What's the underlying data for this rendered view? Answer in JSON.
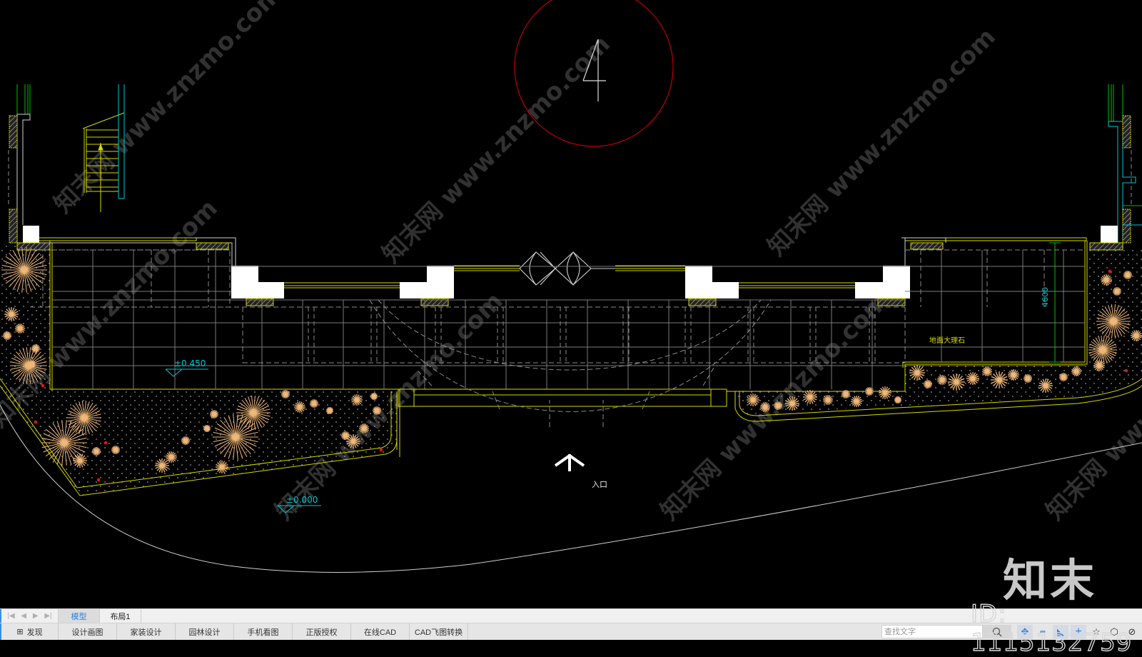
{
  "drawing": {
    "section_marker": "4",
    "level_upper": "±0.450",
    "level_lower": "±0.000",
    "dimension": "4600",
    "material_label": "地面大理石",
    "entrance_label": "入口",
    "watermark_url": "www.znzmo.com",
    "watermark_brand": "知末网",
    "logo_text": "知末",
    "id_text": "ID: 1115132759",
    "colors": {
      "background": "#000000",
      "wall": "#ffffff",
      "yellow_line": "#d8d800",
      "grid_line": "#8a8a8a",
      "cyan": "#00c8d8",
      "green": "#00c000",
      "plant": "#f0b878",
      "section_circle": "#c00000",
      "red_dot": "#ff1010"
    }
  },
  "layout_tabs": {
    "nav": [
      "first-icon",
      "prev-icon",
      "next-icon",
      "last-icon"
    ],
    "tabs": [
      {
        "label": "模型",
        "active": true
      },
      {
        "label": "布局1",
        "active": false
      }
    ]
  },
  "toolbar": {
    "buttons": [
      {
        "label": "发现",
        "icon": "grid-icon"
      },
      {
        "label": "设计画图"
      },
      {
        "label": "家装设计"
      },
      {
        "label": "园林设计"
      },
      {
        "label": "手机看图"
      },
      {
        "label": "正版授权"
      },
      {
        "label": "在线CAD"
      },
      {
        "label": "CAD飞图转换"
      }
    ],
    "search_placeholder": "查找文字",
    "search_value": "",
    "icons": [
      "snap-points-icon",
      "ortho-north-icon",
      "measure-icon",
      "crosshair-icon",
      "favorite-star-icon",
      "3d-box-icon",
      "orbit-icon"
    ]
  }
}
